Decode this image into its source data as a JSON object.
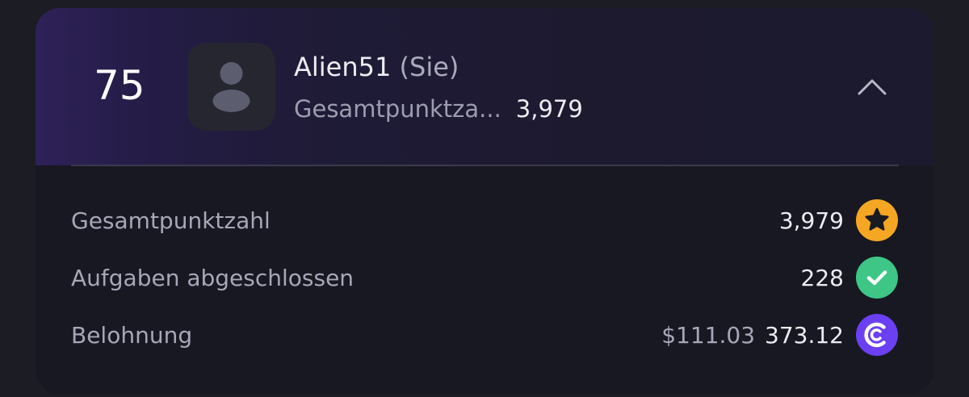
{
  "entry": {
    "rank": "75",
    "name": "Alien51",
    "you_tag": "(Sie)",
    "summary_label": "Gesamtpunktza...",
    "summary_value": "3,979"
  },
  "icons": {
    "avatar": "user-placeholder-icon",
    "collapse": "chevron-up-icon",
    "score": "star-icon",
    "tasks": "checkmark-icon",
    "reward": "token-icon"
  },
  "colors": {
    "star_badge": "#F5A623",
    "check_badge": "#3DC686",
    "token_badge": "#6B3FF2"
  },
  "stats": [
    {
      "label": "Gesamtpunktzahl",
      "value": "3,979",
      "secondary": ""
    },
    {
      "label": "Aufgaben abgeschlossen",
      "value": "228",
      "secondary": ""
    },
    {
      "label": "Belohnung",
      "value": "373.12",
      "secondary": "$111.03"
    }
  ]
}
